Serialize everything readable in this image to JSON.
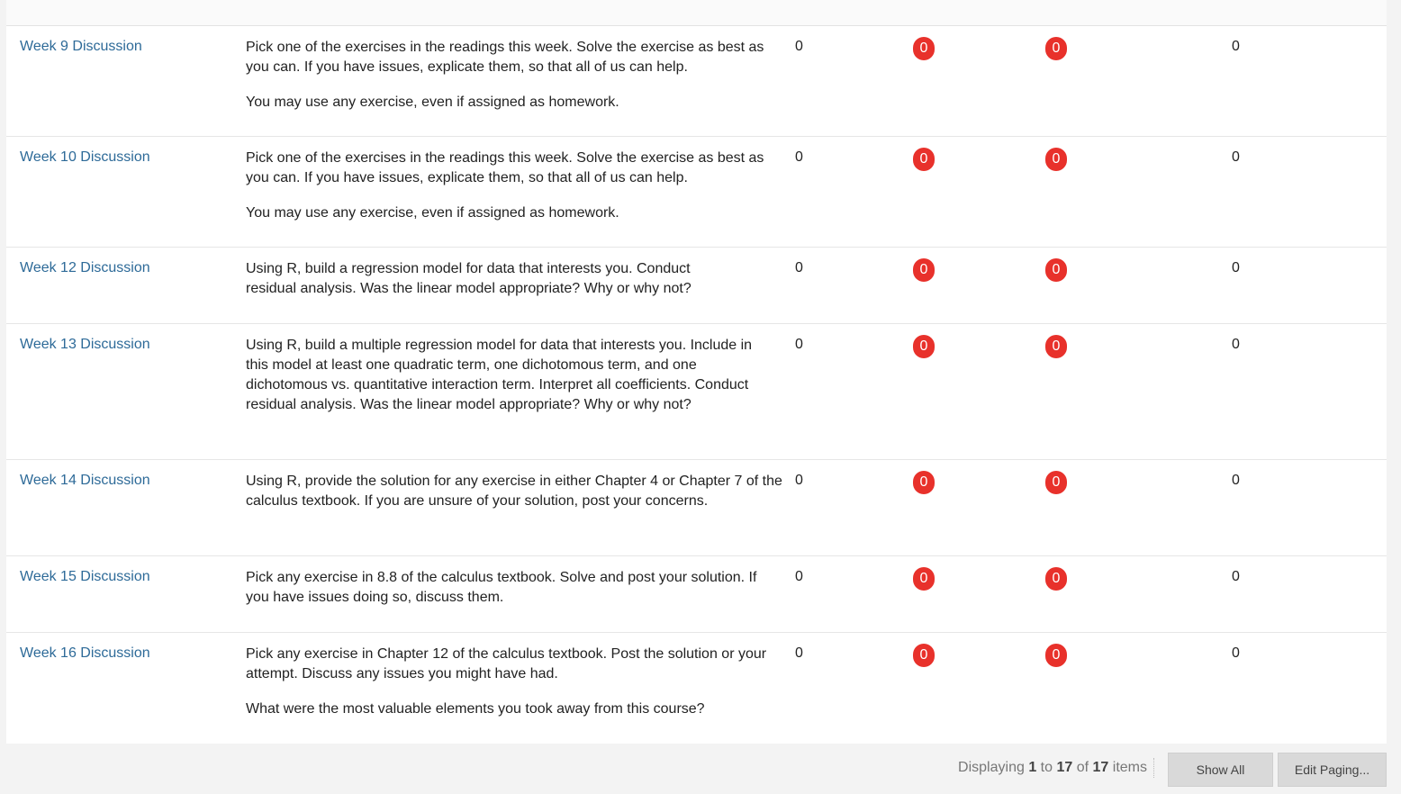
{
  "rows": [
    {
      "title": "Week 9 Discussion",
      "desc": [
        "Pick one of the exercises in the readings this week.  Solve the exercise as best as you can.  If you have issues, explicate them, so that all of us can help.",
        "You may use any exercise, even if assigned as homework."
      ],
      "total_posts": "0",
      "unread_posts": "0",
      "replies_to_me": "0",
      "participants": "0"
    },
    {
      "title": "Week 10 Discussion",
      "desc": [
        "Pick one of the exercises in the readings this week.  Solve the exercise as best as you can.  If you have issues, explicate them, so that all of us can help.",
        "You may use any exercise, even if assigned as homework."
      ],
      "total_posts": "0",
      "unread_posts": "0",
      "replies_to_me": "0",
      "participants": "0"
    },
    {
      "title": "Week 12 Discussion",
      "desc": [
        "Using R, build a  regression model for data that interests you. Conduct residual analysis.  Was the linear model appropriate? Why or why not?"
      ],
      "total_posts": "0",
      "unread_posts": "0",
      "replies_to_me": "0",
      "participants": "0"
    },
    {
      "title": "Week 13 Discussion",
      "desc": [
        "Using R, build a multiple regression model for data that interests you.  Include in this model at least one quadratic term, one dichotomous term, and one dichotomous vs. quantitative interaction term.  Interpret all coefficients. Conduct residual analysis.  Was the linear model appropriate? Why or why not?"
      ],
      "total_posts": "0",
      "unread_posts": "0",
      "replies_to_me": "0",
      "participants": "0"
    },
    {
      "title": "Week 14 Discussion",
      "desc": [
        "Using R, provide the solution for any exercise in either Chapter 4 or Chapter 7 of the calculus textbook.  If you are unsure of your solution, post your concerns."
      ],
      "total_posts": "0",
      "unread_posts": "0",
      "replies_to_me": "0",
      "participants": "0"
    },
    {
      "title": "Week 15 Discussion",
      "desc": [
        "Pick any exercise in 8.8 of the calculus textbook.  Solve and post your solution.  If you have issues doing so, discuss them."
      ],
      "total_posts": "0",
      "unread_posts": "0",
      "replies_to_me": "0",
      "participants": "0"
    },
    {
      "title": "Week 16 Discussion",
      "desc": [
        "Pick any exercise in Chapter 12 of the calculus textbook.  Post the solution or your attempt.  Discuss any issues you might have had.",
        "What were the most valuable elements you took away from this course?"
      ],
      "total_posts": "0",
      "unread_posts": "0",
      "replies_to_me": "0",
      "participants": "0"
    }
  ],
  "footer": {
    "displaying_label": "Displaying",
    "from": "1",
    "to_label": "to",
    "to": "17",
    "of_label": "of",
    "total": "17",
    "items_label": "items",
    "show_all_label": "Show All",
    "edit_paging_label": "Edit Paging..."
  },
  "colors": {
    "link": "#2d6a98",
    "badge": "#e8312b"
  }
}
